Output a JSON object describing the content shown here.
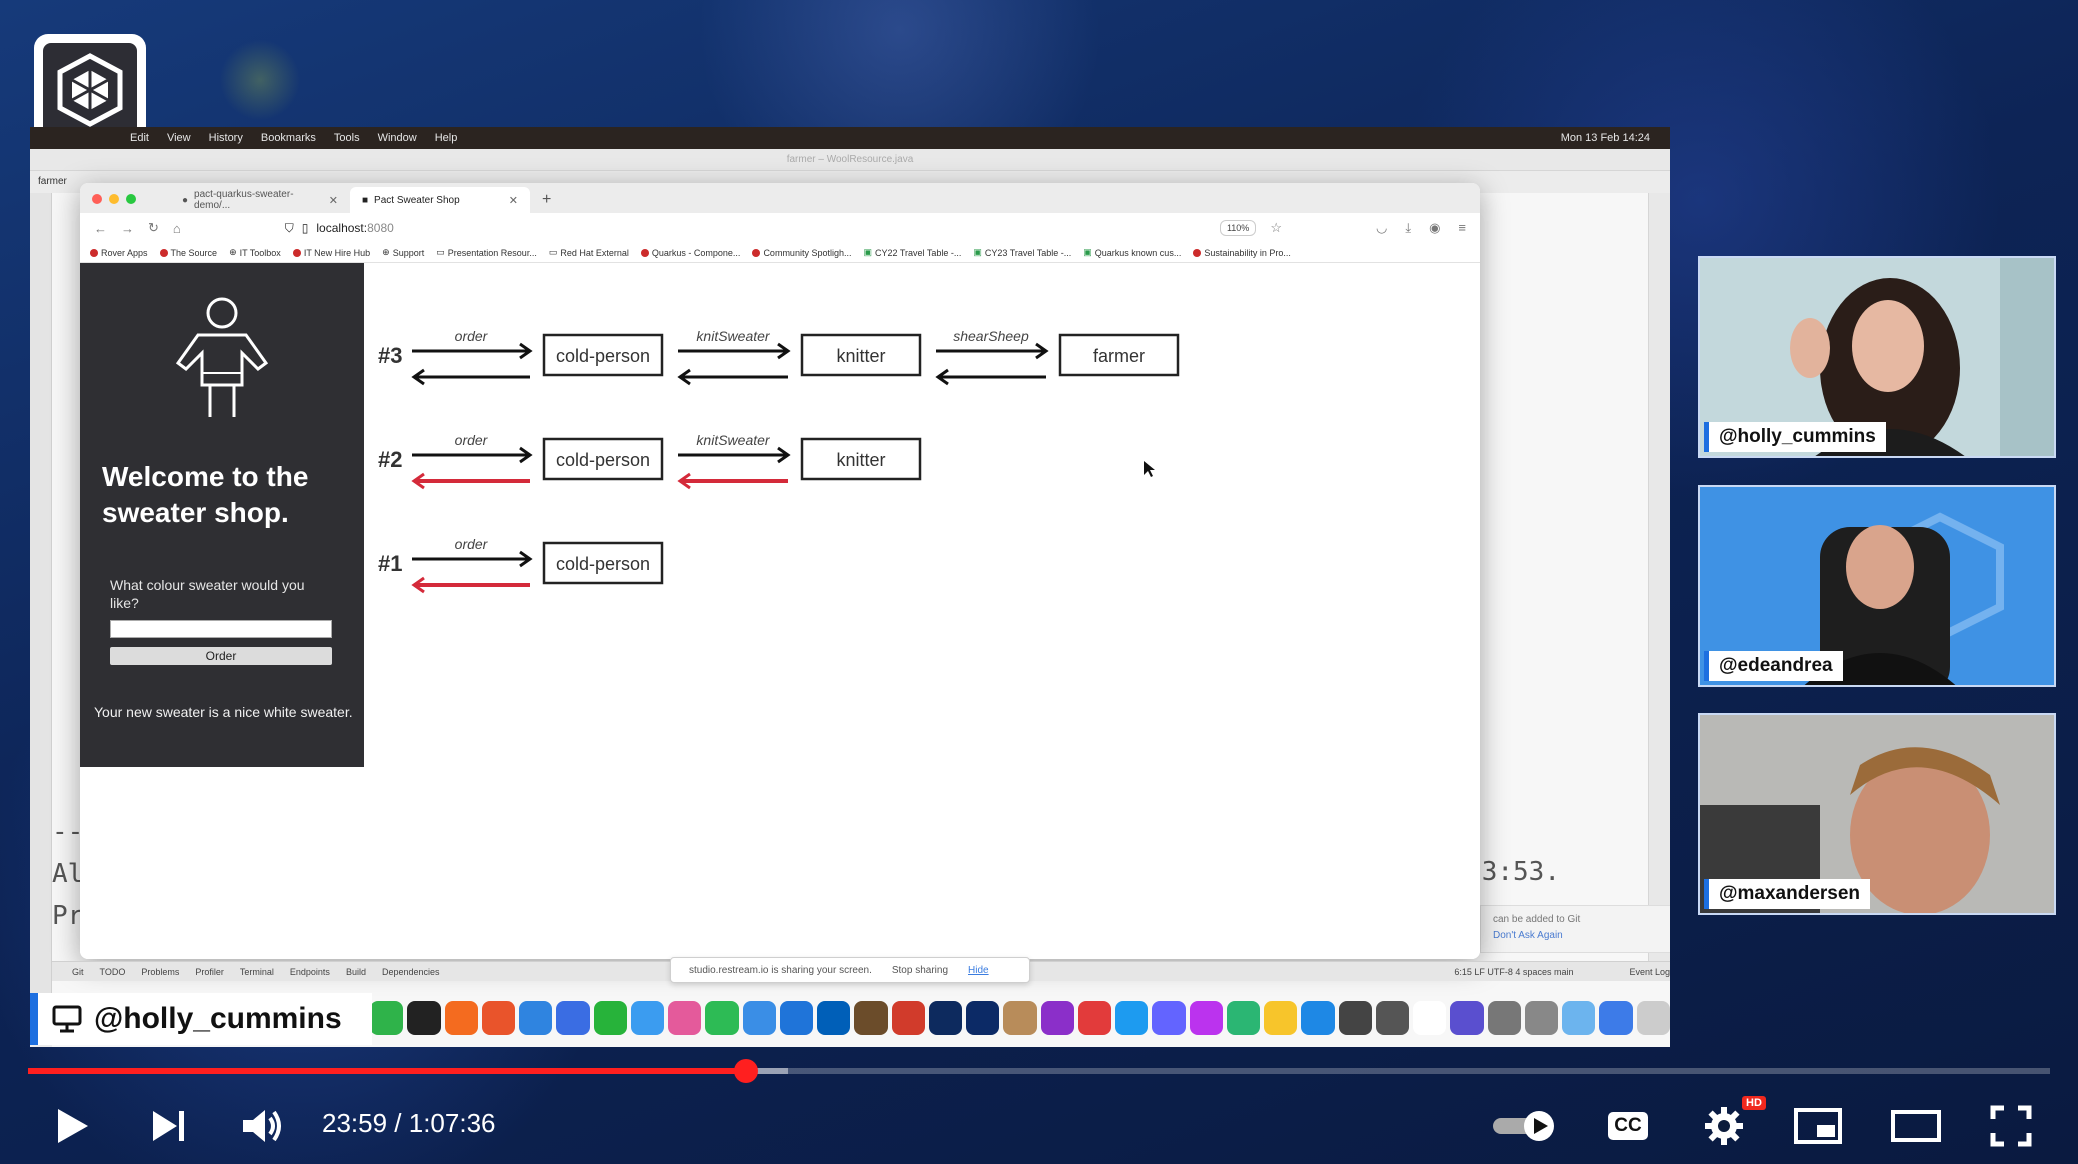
{
  "mac": {
    "menus": [
      "Edit",
      "View",
      "History",
      "Bookmarks",
      "Tools",
      "Window",
      "Help"
    ],
    "clock": "Mon 13 Feb  14:24",
    "ide_title": "farmer – WoolResource.java",
    "ide_project": "farmer",
    "code_lines": [
      "--",
      "Al",
      "Pr"
    ],
    "ide_time_fragment": "3:53.",
    "notice_text": "can be added to Git",
    "notice_link": "Don't Ask Again",
    "status_left": [
      "Git",
      "TODO",
      "Problems",
      "Profiler",
      "Terminal",
      "Endpoints",
      "Build",
      "Dependencies"
    ],
    "status_right": "6:15  LF  UTF-8  4 spaces  main",
    "event_log": "Event Log"
  },
  "browser": {
    "tabs": [
      {
        "label": "pact-quarkus-sweater-demo/..."
      },
      {
        "label": "Pact Sweater Shop"
      }
    ],
    "url_host": "localhost:",
    "url_port": "8080",
    "zoom": "110%",
    "bookmarks": [
      "Rover Apps",
      "The Source",
      "IT Toolbox",
      "IT New Hire Hub",
      "Support",
      "Presentation Resour...",
      "Red Hat External",
      "Quarkus - Compone...",
      "Community Spotligh...",
      "CY22 Travel Table -...",
      "CY23 Travel Table -...",
      "Quarkus known cus...",
      "Sustainability in Pro..."
    ]
  },
  "shop": {
    "title": "Welcome to the sweater shop.",
    "question": "What colour sweater would you like?",
    "order_button": "Order",
    "response": "Your new sweater is a nice white sweater."
  },
  "diagram": {
    "rows": [
      {
        "label": "#3",
        "nodes": [
          "cold-person",
          "knitter",
          "farmer"
        ],
        "arrows": [
          "order",
          "knitSweater",
          "shearSheep"
        ],
        "failed_returns": []
      },
      {
        "label": "#2",
        "nodes": [
          "cold-person",
          "knitter"
        ],
        "arrows": [
          "order",
          "knitSweater"
        ],
        "failed_returns": [
          0,
          1
        ]
      },
      {
        "label": "#1",
        "nodes": [
          "cold-person"
        ],
        "arrows": [
          "order"
        ],
        "failed_returns": [
          0
        ]
      }
    ],
    "colors": {
      "ok": "#111111",
      "failed": "#d42a3a"
    }
  },
  "screen_share": {
    "text": "studio.restream.io is sharing your screen.",
    "stop": "Stop sharing",
    "hide": "Hide"
  },
  "presenter_tag": "@holly_cummins",
  "cams": [
    {
      "handle": "@holly_cummins"
    },
    {
      "handle": "@edeandrea"
    },
    {
      "handle": "@maxandersen"
    }
  ],
  "player": {
    "current_time": "23:59",
    "separator": " / ",
    "duration": "1:07:36",
    "progress": 0.3551,
    "buffered": 0.376,
    "cc_label": "CC",
    "hd_badge": "HD",
    "colors": {
      "played": "#ff1f1f"
    }
  }
}
